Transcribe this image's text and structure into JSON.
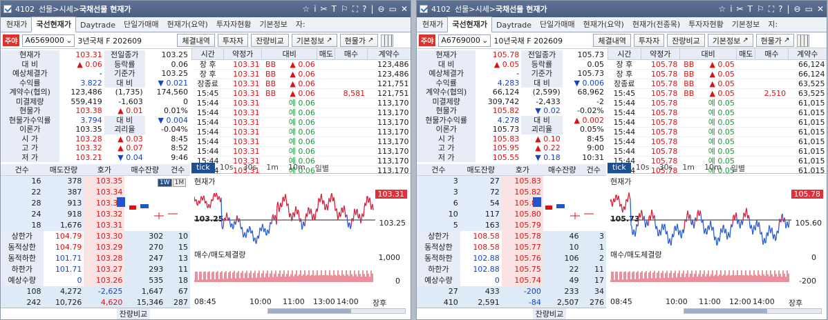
{
  "panels": [
    {
      "title": {
        "code": "4102",
        "path": "선물>시세>",
        "name": "국채선물 현재가"
      },
      "tabs": [
        "현재가",
        "국선현재가",
        "Daytrade",
        "단일가매매",
        "현재가(요약)",
        "투자자현황",
        "기본정보",
        "자:"
      ],
      "active_tab": 1,
      "control": {
        "badge": "주야",
        "code": "A6569000",
        "name": "3년국채 F 202609",
        "buttons": [
          "체결내역",
          "투자자",
          "잔량비교",
          "기본정보",
          "현물가"
        ]
      },
      "info": [
        [
          "현재가",
          "103.31",
          "전일종가",
          "103.25"
        ],
        [
          "대  비",
          "▲  0.06",
          "등락률",
          "0.06"
        ],
        [
          "예상체결가",
          "-",
          "기준가",
          "103.25"
        ],
        [
          "수익률",
          "3.822",
          "대  비",
          "▼  0.021"
        ],
        [
          "계약수(협의)",
          "123,486",
          "(1,735)",
          "174,560"
        ],
        [
          "미결제량",
          "559,419",
          "-1,603",
          "0"
        ],
        [
          "현물가",
          "103.38",
          "▲  0.01",
          "0.01%"
        ],
        [
          "현물가수익률",
          "3.794",
          "대  비",
          "▼  0.004"
        ],
        [
          "이론가",
          "103.35",
          "괴리율",
          "-0.04%"
        ],
        [
          "시  가",
          "103.28",
          "▲  0.03",
          "8:45"
        ],
        [
          "고  가",
          "103.32",
          "▲  0.07",
          "8:52"
        ],
        [
          "저  가",
          "103.21",
          "▼  0.04",
          "9:46"
        ]
      ],
      "trade_headers": [
        "시간",
        "약정가",
        "대비",
        "매도",
        "매수",
        "계약수"
      ],
      "trades": [
        [
          "장 후",
          "103.31",
          "BB",
          "▲ 0.06",
          "",
          "",
          "123,486"
        ],
        [
          "장 후",
          "103.31",
          "BB",
          "▲ 0.06",
          "",
          "",
          "123,486"
        ],
        [
          "장종료",
          "103.31",
          "BB",
          "▲ 0.06",
          "",
          "",
          "121,751"
        ],
        [
          "15:45",
          "103.31",
          "BB",
          "▲ 0.06",
          "",
          "8,581",
          "121,751"
        ],
        [
          "15:44",
          "103.31",
          "",
          "예 0.06",
          "",
          "",
          "113,170"
        ],
        [
          "15:44",
          "103.31",
          "",
          "예 0.06",
          "",
          "",
          "113,170"
        ],
        [
          "15:44",
          "103.31",
          "",
          "예 0.06",
          "",
          "",
          "113,170"
        ],
        [
          "15:44",
          "103.31",
          "",
          "예 0.06",
          "",
          "",
          "113,170"
        ],
        [
          "15:44",
          "103.31",
          "",
          "예 0.06",
          "",
          "",
          "113,170"
        ],
        [
          "15:44",
          "103.31",
          "",
          "예 0.06",
          "",
          "",
          "113,170"
        ],
        [
          "15:44",
          "103.31",
          "",
          "예 0.06",
          "",
          "",
          "113,170"
        ],
        [
          "15:44",
          "103.31",
          "",
          "예 0.06",
          "",
          "",
          "113,170"
        ]
      ],
      "tick_tabs": [
        "tick",
        "10s",
        "30s",
        "1m",
        "10m",
        "일별"
      ],
      "ob_headers": [
        "건수",
        "매도잔량",
        "호가",
        "매수잔량",
        "건수"
      ],
      "asks": [
        [
          "16",
          "378",
          "103.35"
        ],
        [
          "22",
          "387",
          "103.34"
        ],
        [
          "28",
          "913",
          "103.33"
        ],
        [
          "24",
          "918",
          "103.32"
        ],
        [
          "18",
          "1,676",
          "103.31"
        ]
      ],
      "bids": [
        [
          "상한가",
          "104.79",
          "103.30",
          "302",
          "10"
        ],
        [
          "동적상한",
          "104.79",
          "103.29",
          "270",
          "15"
        ],
        [
          "동적하한",
          "101.71",
          "103.28",
          "247",
          "13"
        ],
        [
          "하한가",
          "101.71",
          "103.27",
          "293",
          "11"
        ],
        [
          "예상수량",
          "0",
          "103.26",
          "535",
          "18"
        ]
      ],
      "totals": [
        [
          "108",
          "4,272",
          "-2,625",
          "1,647",
          "67"
        ],
        [
          "242",
          "10,726",
          "4,620",
          "15,346",
          "287"
        ]
      ],
      "bottom_label": "잔량비교",
      "chart": {
        "price_label": "현재가",
        "vol_label": "매수/매도체결량",
        "last": "103.31",
        "base": "103.25",
        "base_right": "103.25",
        "vol_top": "1,000",
        "vol_zero": "0",
        "x_labels": [
          "08:45",
          "10:00",
          "11:00",
          "13:00",
          "14:00",
          "장후"
        ]
      },
      "chart_data": {
        "type": "line",
        "title": "현재가",
        "x": [
          "08:45",
          "10:00",
          "11:00",
          "13:00",
          "14:00",
          "장후"
        ],
        "reference": 103.25,
        "last": 103.31
      },
      "minibar": [
        "1W",
        "1M"
      ]
    },
    {
      "title": {
        "code": "4102",
        "path": "선물>시세>",
        "name": "국채선물 현재가"
      },
      "tabs": [
        "현재가",
        "국선현재가",
        "Daytrade",
        "단일가매매",
        "현재가(요약)",
        "현재가(전종목)",
        "투자자현황",
        "기본정보",
        "지:"
      ],
      "active_tab": 1,
      "control": {
        "badge": "주야",
        "code": "A6769000",
        "name": "10년국채 F 202609",
        "buttons": [
          "체결내역",
          "투자자",
          "잔량비교",
          "기본정보",
          "현물가"
        ]
      },
      "info": [
        [
          "현재가",
          "105.78",
          "전일종가",
          "105.73"
        ],
        [
          "대  비",
          "▲  0.05",
          "등락률",
          "0.05"
        ],
        [
          "예상체결가",
          "-",
          "기준가",
          "105.73"
        ],
        [
          "수익률",
          "4.283",
          "대  비",
          "▼  0.006"
        ],
        [
          "계약수(협의)",
          "66,124",
          "(2,599)",
          "68,962"
        ],
        [
          "미결제량",
          "309,742",
          "-2,433",
          "-2"
        ],
        [
          "현물가",
          "105.82",
          "▼  0.02",
          "-0.02%"
        ],
        [
          "현물가수익률",
          "4.278",
          "대  비",
          "▲  0.002"
        ],
        [
          "이론가",
          "105.73",
          "괴리율",
          "0.05%"
        ],
        [
          "시  가",
          "105.83",
          "▲  0.10",
          "8:45"
        ],
        [
          "고  가",
          "105.95",
          "▲  0.22",
          "9:00"
        ],
        [
          "저  가",
          "105.55",
          "▼  0.18",
          "10:31"
        ]
      ],
      "trade_headers": [
        "시간",
        "약정가",
        "대비",
        "매도",
        "매수",
        "계약수"
      ],
      "trades": [
        [
          "장 후",
          "105.78",
          "BB",
          "▲ 0.05",
          "",
          "",
          "66,124"
        ],
        [
          "장 후",
          "105.78",
          "BB",
          "▲ 0.05",
          "",
          "",
          "66,124"
        ],
        [
          "장종료",
          "105.78",
          "BB",
          "▲ 0.05",
          "",
          "",
          "63,525"
        ],
        [
          "15:45",
          "105.78",
          "BB",
          "▲ 0.05",
          "",
          "2,510",
          "63,525"
        ],
        [
          "15:44",
          "105.78",
          "",
          "예 0.05",
          "",
          "",
          "61,015"
        ],
        [
          "15:44",
          "105.78",
          "",
          "예 0.05",
          "",
          "",
          "61,015"
        ],
        [
          "15:44",
          "105.78",
          "",
          "예 0.05",
          "",
          "",
          "61,015"
        ],
        [
          "15:44",
          "105.78",
          "",
          "예 0.05",
          "",
          "",
          "61,015"
        ],
        [
          "15:44",
          "105.78",
          "",
          "예 0.05",
          "",
          "",
          "61,015"
        ],
        [
          "15:44",
          "105.78",
          "",
          "예 0.05",
          "",
          "",
          "61,015"
        ],
        [
          "15:44",
          "105.78",
          "",
          "예 0.05",
          "",
          "",
          "61,015"
        ],
        [
          "15:44",
          "105.78",
          "",
          "예 0.05",
          "",
          "",
          "61,015"
        ]
      ],
      "tick_tabs": [
        "tick",
        "10s",
        "30s",
        "1m",
        "10m",
        "일별"
      ],
      "ob_headers": [
        "건수",
        "매도잔량",
        "호가",
        "매수잔량",
        "건수"
      ],
      "asks": [
        [
          "3",
          "27",
          "105.83"
        ],
        [
          "3",
          "72",
          "105.82"
        ],
        [
          "6",
          "54",
          "105.81"
        ],
        [
          "10",
          "117",
          "105.80"
        ],
        [
          "5",
          "163",
          "105.79"
        ]
      ],
      "bids": [
        [
          "상한가",
          "108.58",
          "105.78",
          "46",
          "3"
        ],
        [
          "동적상한",
          "108.58",
          "105.77",
          "10",
          "1"
        ],
        [
          "동적하한",
          "102.88",
          "105.76",
          "106",
          "2"
        ],
        [
          "하한가",
          "102.88",
          "105.75",
          "22",
          "11"
        ],
        [
          "예상수량",
          "0",
          "105.74",
          "49",
          "17"
        ]
      ],
      "totals": [
        [
          "27",
          "433",
          "-200",
          "233",
          "34"
        ],
        [
          "410",
          "2,591",
          "-84",
          "2,507",
          "276"
        ]
      ],
      "bottom_label": "잔량비교",
      "chart": {
        "price_label": "현재가",
        "vol_label": "매수/매도체결량",
        "last": "105.78",
        "base": "105.73",
        "base_right": "105.60",
        "vol_top": "0",
        "vol_zero": "-200",
        "x_labels": [
          "08:45",
          "10:00",
          "11:00",
          "12:00",
          "14:00",
          "장후"
        ]
      },
      "chart_data": {
        "type": "line",
        "title": "현재가",
        "x": [
          "08:45",
          "10:00",
          "11:00",
          "12:00",
          "14:00",
          "장후"
        ],
        "reference": 105.73,
        "last": 105.78
      },
      "minibar": []
    }
  ]
}
